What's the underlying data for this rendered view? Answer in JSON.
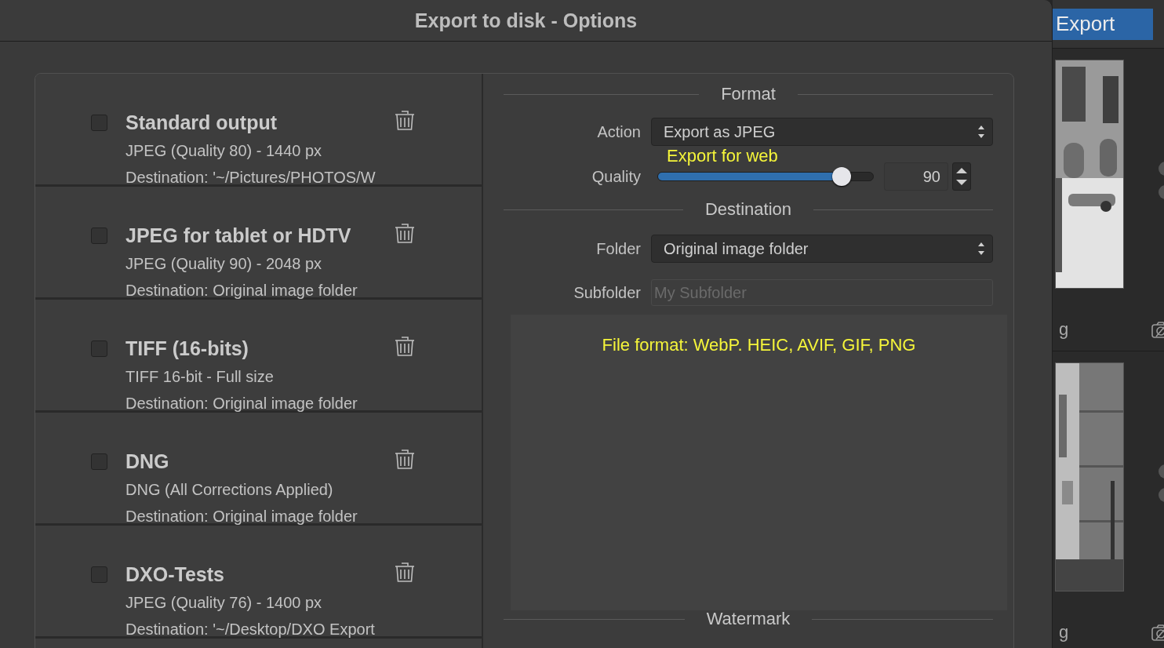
{
  "dialog": {
    "title": "Export to disk - Options"
  },
  "presets": [
    {
      "name": "Standard output",
      "format": "JPEG (Quality 80) - 1440 px",
      "destination": "Destination: '~/Pictures/PHOTOS/W",
      "checked": false
    },
    {
      "name": "JPEG for tablet or HDTV",
      "format": "JPEG (Quality 90) - 2048 px",
      "destination": "Destination: Original image folder",
      "checked": false
    },
    {
      "name": "TIFF (16-bits)",
      "format": "TIFF 16-bit - Full size",
      "destination": "Destination: Original image folder",
      "checked": false
    },
    {
      "name": "DNG",
      "format": "DNG (All Corrections Applied)",
      "destination": "Destination: Original image folder",
      "checked": false
    },
    {
      "name": "DXO-Tests",
      "format": "JPEG (Quality 76) - 1400 px",
      "destination": "Destination: '~/Desktop/DXO Export",
      "checked": false
    }
  ],
  "format_section": {
    "heading": "Format",
    "action": {
      "label": "Action",
      "value": "Export as JPEG"
    },
    "quality": {
      "label": "Quality",
      "level": 0.86,
      "value": "90",
      "note": "Export for web"
    }
  },
  "destination_section": {
    "heading": "Destination",
    "folder": {
      "label": "Folder",
      "value": "Original image folder"
    },
    "subfolder": {
      "label": "Subfolder",
      "placeholder": "My Subfolder"
    }
  },
  "info_panel": {
    "note": "File format: WebP. HEIC, AVIF, GIF, PNG"
  },
  "watermark_section": {
    "heading": "Watermark"
  },
  "side_panel": {
    "export_button": "Export",
    "thumbnails": [
      {
        "caption": "g",
        "kind": "building"
      },
      {
        "caption": "g",
        "kind": "wall"
      }
    ]
  }
}
